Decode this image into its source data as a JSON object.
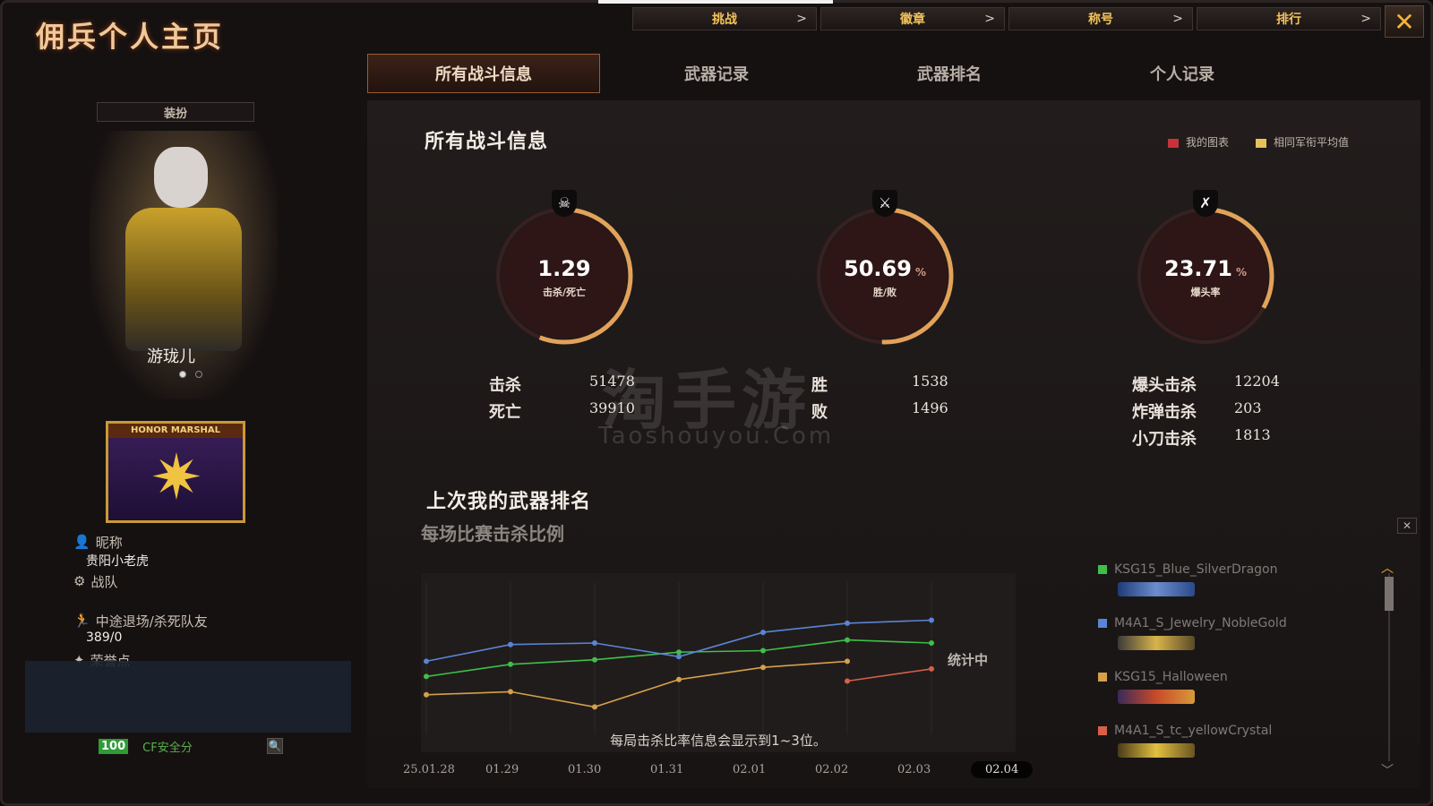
{
  "header": {
    "title": "佣兵个人主页",
    "nav": [
      {
        "label": "挑战",
        "chev": ">"
      },
      {
        "label": "徽章",
        "chev": ">"
      },
      {
        "label": "称号",
        "chev": ">"
      },
      {
        "label": "排行",
        "chev": ">"
      }
    ],
    "close": "✕"
  },
  "tabs": [
    "所有战斗信息",
    "武器记录",
    "武器排名",
    "个人记录"
  ],
  "left": {
    "costume_label": "装扮",
    "character_name": "游珑儿",
    "badge_banner": "HONOR MARSHAL",
    "badge_icon": "✷",
    "info": [
      {
        "icon": "user-icon",
        "label": "昵称",
        "value": "贵阳小老虎"
      },
      {
        "icon": "team-icon",
        "label": "战队",
        "value": ""
      },
      {
        "icon": "run-icon",
        "label": "中途退场/杀死队友",
        "value": "389/0"
      },
      {
        "icon": "honor-icon",
        "label": "荣誉点",
        "value": ""
      }
    ],
    "score": "100",
    "safe_label": "CF安全分",
    "search_icon": "🔍"
  },
  "panel": {
    "title": "所有战斗信息",
    "legend": [
      {
        "label": "我的图表",
        "color": "#c8323a"
      },
      {
        "label": "相同军衔平均值",
        "color": "#e7c25a"
      }
    ],
    "gauges": [
      {
        "value": "1.29",
        "unit": "",
        "label": "击杀/死亡",
        "icon": "☠",
        "fraction": 0.56
      },
      {
        "value": "50.69",
        "unit": "%",
        "label": "胜/败",
        "icon": "⚔",
        "fraction": 0.5069
      },
      {
        "value": "23.71",
        "unit": "%",
        "label": "爆头率",
        "icon": "✗",
        "fraction": 0.33
      }
    ],
    "stats": [
      {
        "k": "击杀",
        "v": "51478"
      },
      {
        "k": "死亡",
        "v": "39910"
      },
      {
        "k": "胜",
        "v": "1538"
      },
      {
        "k": "败",
        "v": "1496"
      },
      {
        "k": "爆头击杀",
        "v": "12204"
      },
      {
        "k": "炸弹击杀",
        "v": "203"
      },
      {
        "k": "小刀击杀",
        "v": "1813"
      }
    ],
    "watermark": "淘手游",
    "watermark_sub": "Taoshouyou.Com",
    "rank_title": "上次我的武器排名",
    "rank_sub": "每场比赛击杀比例",
    "chart_note": "每局击杀比率信息会显示到1~3位。",
    "chart_status": "统计中",
    "weapons": [
      {
        "name": "KSG15_Blue_SilverDragon",
        "color": "#3fbf4a"
      },
      {
        "name": "M4A1_S_Jewelry_NobleGold",
        "color": "#5a84d6"
      },
      {
        "name": "KSG15_Halloween",
        "color": "#d6a04a"
      },
      {
        "name": "M4A1_S_tc_yellowCrystal",
        "color": "#d6604a"
      }
    ]
  },
  "chart_data": {
    "type": "line",
    "x": [
      "25.01.28",
      "01.29",
      "01.30",
      "01.31",
      "02.01",
      "02.02",
      "02.03",
      "02.04"
    ],
    "selected": "02.04",
    "series": [
      {
        "name": "KSG15_Blue_SilverDragon",
        "color": "#3fbf4a",
        "values": [
          1.9,
          2.3,
          2.45,
          2.7,
          2.75,
          3.1,
          3.0,
          null
        ]
      },
      {
        "name": "M4A1_S_Jewelry_NobleGold",
        "color": "#5a84d6",
        "values": [
          2.4,
          2.95,
          3.0,
          2.55,
          3.35,
          3.65,
          3.75,
          null
        ]
      },
      {
        "name": "KSG15_Halloween",
        "color": "#d6a04a",
        "values": [
          1.3,
          1.4,
          0.9,
          1.8,
          2.2,
          2.4,
          null,
          null
        ]
      },
      {
        "name": "M4A1_S_tc_yellowCrystal",
        "color": "#d6604a",
        "values": [
          null,
          null,
          null,
          null,
          null,
          1.75,
          2.15,
          null
        ]
      }
    ],
    "ylim": [
      0,
      5
    ]
  }
}
